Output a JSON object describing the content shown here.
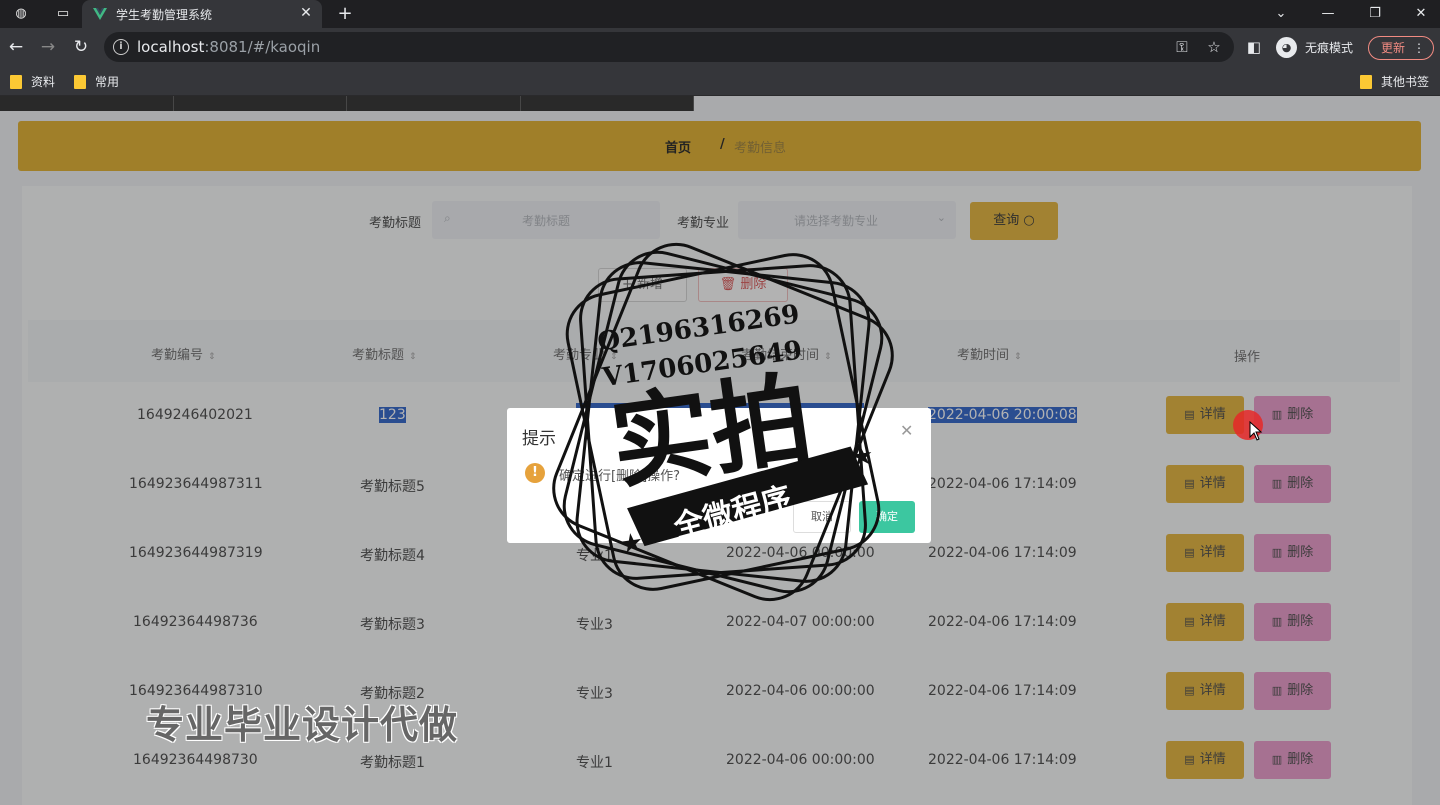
{
  "browser": {
    "tab_title": "学生考勤管理系统",
    "url_host": "localhost",
    "url_rest": ":8081/#/kaoqin",
    "incognito_label": "无痕模式",
    "update_label": "更新",
    "bookmarks": [
      "资料",
      "常用"
    ],
    "other_bookmarks": "其他书签"
  },
  "breadcrumb": {
    "home": "首页",
    "separator": "/",
    "current": "考勤信息"
  },
  "search": {
    "title_label": "考勤标题",
    "title_placeholder": "考勤标题",
    "major_label": "考勤专业",
    "major_placeholder": "请选择考勤专业",
    "button_label": "查询"
  },
  "toolbar": {
    "add_label": "+ 新增",
    "delete_label": "删除"
  },
  "table": {
    "headers": [
      "考勤编号",
      "考勤标题",
      "考勤专业",
      "考勤结束时间",
      "考勤时间",
      "操作"
    ],
    "rows": [
      {
        "id": "1649246402021",
        "title": "123",
        "major": "",
        "end": "",
        "time": "2022-04-06 20:00:08"
      },
      {
        "id": "164923644987311",
        "title": "考勤标题5",
        "major": "",
        "end": "",
        "time": "2022-04-06 17:14:09"
      },
      {
        "id": "164923644987319",
        "title": "考勤标题4",
        "major": "专业1",
        "end": "2022-04-06 00:00:00",
        "time": "2022-04-06 17:14:09"
      },
      {
        "id": "16492364498736",
        "title": "考勤标题3",
        "major": "专业3",
        "end": "2022-04-07 00:00:00",
        "time": "2022-04-06 17:14:09"
      },
      {
        "id": "164923644987310",
        "title": "考勤标题2",
        "major": "专业3",
        "end": "2022-04-06 00:00:00",
        "time": "2022-04-06 17:14:09"
      },
      {
        "id": "16492364498730",
        "title": "考勤标题1",
        "major": "专业1",
        "end": "2022-04-06 00:00:00",
        "time": "2022-04-06 17:14:09"
      }
    ],
    "detail_label": "详情",
    "delete_label": "删除"
  },
  "dialog": {
    "title": "提示",
    "message": "确定进行[删除]操作?",
    "cancel_label": "取消",
    "confirm_label": "确定"
  },
  "watermark": {
    "line1": "Q2196316269",
    "line2": "V1706025649",
    "main": "实拍",
    "banner": "全微程序",
    "caption": "专业毕业设计代做"
  },
  "colors": {
    "accent": "#e6b73c",
    "delete_pink": "#eea3d0",
    "confirm_green": "#3cc7a0",
    "warning": "#e6a23c"
  }
}
